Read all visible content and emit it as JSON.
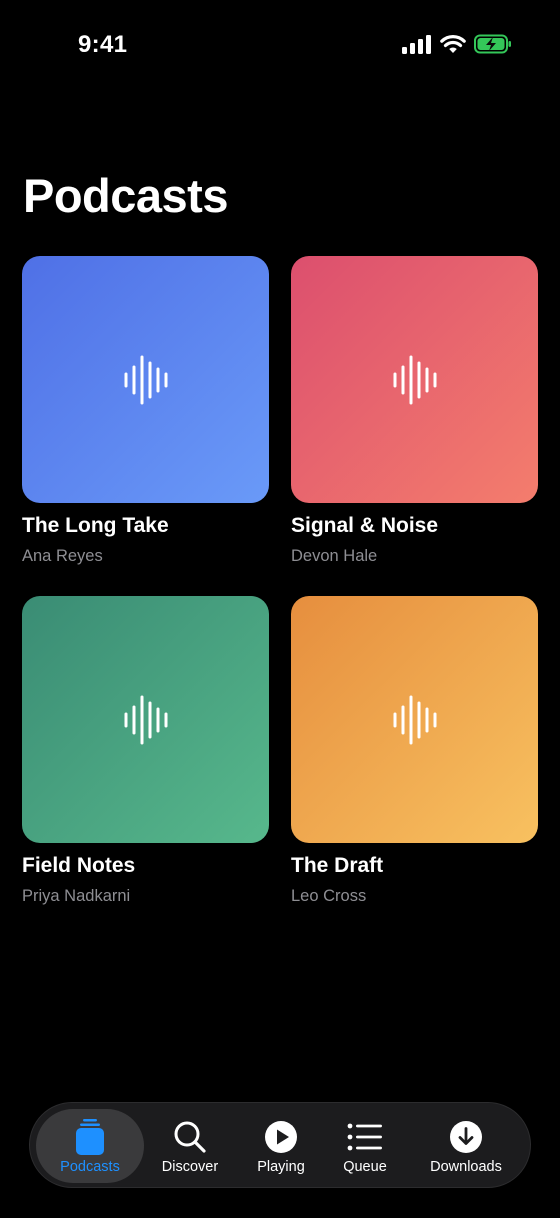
{
  "status_bar": {
    "time": "9:41"
  },
  "page": {
    "title": "Podcasts"
  },
  "podcasts": [
    {
      "title": "The Long Take",
      "author": "Ana Reyes",
      "artwork_color": "#5b7ff0"
    },
    {
      "title": "Signal & Noise",
      "author": "Devon Hale",
      "artwork_color": "#e8636f"
    },
    {
      "title": "Field Notes",
      "author": "Priya Nadkarni",
      "artwork_color": "#48a080"
    },
    {
      "title": "The Draft",
      "author": "Leo Cross",
      "artwork_color": "#f0a84e"
    }
  ],
  "tab_bar": {
    "tabs": [
      {
        "label": "Podcasts",
        "icon": "podcasts-stack-icon",
        "active": true
      },
      {
        "label": "Discover",
        "icon": "search-icon",
        "active": false
      },
      {
        "label": "Playing",
        "icon": "play-circle-icon",
        "active": false
      },
      {
        "label": "Queue",
        "icon": "list-icon",
        "active": false
      },
      {
        "label": "Downloads",
        "icon": "download-circle-icon",
        "active": false
      }
    ],
    "active_color": "#1e90ff"
  }
}
